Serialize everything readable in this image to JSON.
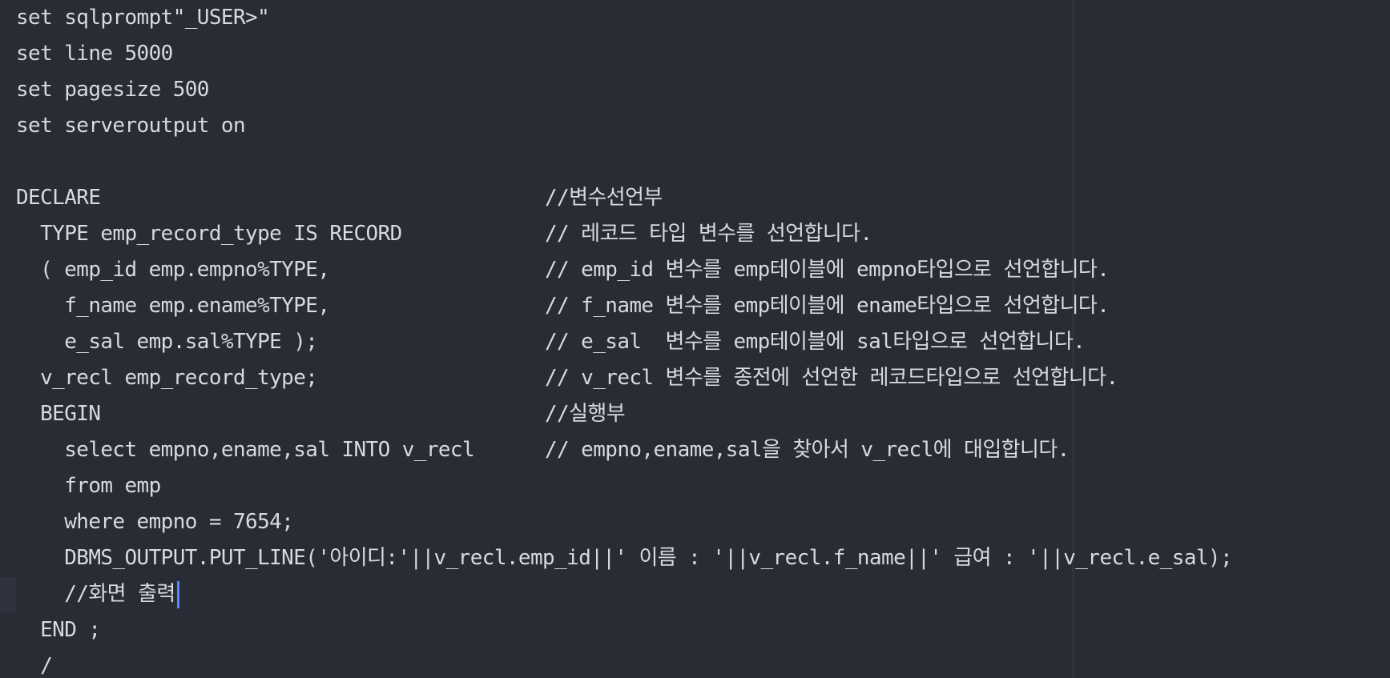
{
  "editor": {
    "lines": [
      {
        "code": "set sqlprompt\"_USER>\"",
        "comment": ""
      },
      {
        "code": "set line 5000",
        "comment": ""
      },
      {
        "code": "set pagesize 500",
        "comment": ""
      },
      {
        "code": "set serveroutput on",
        "comment": ""
      },
      {
        "code": "",
        "comment": ""
      },
      {
        "code": "DECLARE",
        "comment": "//변수선언부"
      },
      {
        "code": "  TYPE emp_record_type IS RECORD",
        "comment": "// 레코드 타입 변수를 선언합니다."
      },
      {
        "code": "  ( emp_id emp.empno%TYPE,",
        "comment": "// emp_id 변수를 emp테이블에 empno타입으로 선언합니다."
      },
      {
        "code": "    f_name emp.ename%TYPE,",
        "comment": "// f_name 변수를 emp테이블에 ename타입으로 선언합니다."
      },
      {
        "code": "    e_sal emp.sal%TYPE );",
        "comment": "// e_sal  변수를 emp테이블에 sal타입으로 선언합니다."
      },
      {
        "code": "  v_recl emp_record_type;",
        "comment": "// v_recl 변수를 종전에 선언한 레코드타입으로 선언합니다."
      },
      {
        "code": "  BEGIN",
        "comment": "//실행부"
      },
      {
        "code": "    select empno,ename,sal INTO v_recl",
        "comment": "// empno,ename,sal을 찾아서 v_recl에 대입합니다."
      },
      {
        "code": "    from emp",
        "comment": ""
      },
      {
        "code": "    where empno = 7654;",
        "comment": ""
      },
      {
        "code": "    DBMS_OUTPUT.PUT_LINE('아이디:'||v_recl.emp_id||' 이름 : '||v_recl.f_name||' 급여 : '||v_recl.e_sal);",
        "comment": ""
      },
      {
        "code": "    //화면 출력",
        "comment": ""
      },
      {
        "code": "  END ;",
        "comment": ""
      },
      {
        "code": "  /",
        "comment": ""
      }
    ],
    "current_line": 16,
    "colors": {
      "background": "#282c34",
      "text": "#d7dae0",
      "cursor": "#528bff",
      "squiggle": "#e06c75",
      "ruler": "#3b404a"
    }
  }
}
